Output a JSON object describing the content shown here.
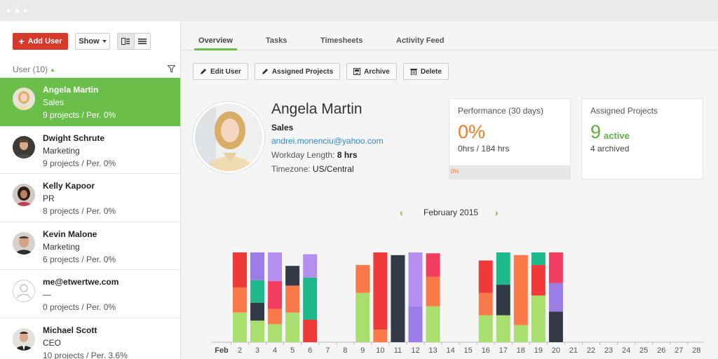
{
  "sidebar": {
    "add_user_label": "Add User",
    "show_label": "Show",
    "list_header": "User (10)",
    "users": [
      {
        "name": "Angela Martin",
        "dept": "Sales",
        "stats": "9 projects / Per. 0%",
        "selected": true
      },
      {
        "name": "Dwight Schrute",
        "dept": "Marketing",
        "stats": "9 projects / Per. 0%"
      },
      {
        "name": "Kelly Kapoor",
        "dept": "PR",
        "stats": "8 projects / Per. 0%"
      },
      {
        "name": "Kevin Malone",
        "dept": "Marketing",
        "stats": "6 projects / Per. 0%"
      },
      {
        "name": "me@etwertwe.com",
        "dept": "—",
        "stats": "0 projects / Per. 0%"
      },
      {
        "name": "Michael Scott",
        "dept": "CEO",
        "stats": "10 projects / Per. 3.6%"
      }
    ]
  },
  "tabs": [
    "Overview",
    "Tasks",
    "Timesheets",
    "Activity Feed"
  ],
  "actions": {
    "edit_user": "Edit User",
    "assigned_projects": "Assigned Projects",
    "archive": "Archive",
    "delete": "Delete"
  },
  "profile": {
    "name": "Angela Martin",
    "dept": "Sales",
    "email": "andrei.monenciu@yahoo.com",
    "workday_label": "Workday Length:",
    "workday_value": "8 hrs",
    "timezone_label": "Timezone:",
    "timezone_value": "US/Central"
  },
  "performance": {
    "label": "Performance (30 days)",
    "value": "0%",
    "hours": "0hrs / 184 hrs",
    "bar_label": "0%",
    "bar_fraction": 0
  },
  "projects": {
    "label": "Assigned Projects",
    "active_count": "9",
    "active_label": "active",
    "archived": "4 archived"
  },
  "calendar": {
    "month": "February 2015"
  },
  "colors": {
    "green": "#6abf4b",
    "red": "#d63a2b",
    "orange": "#f47b20",
    "link": "#2a8ad8"
  },
  "chart_data": {
    "type": "bar",
    "stacked": true,
    "x_prefix_label": "Feb",
    "categories": [
      "2",
      "3",
      "4",
      "5",
      "6",
      "7",
      "8",
      "9",
      "10",
      "11",
      "12",
      "13",
      "14",
      "15",
      "16",
      "17",
      "18",
      "19",
      "20",
      "21",
      "22",
      "23",
      "24",
      "25",
      "26",
      "27",
      "28"
    ],
    "palette": {
      "g": "#a9df6e",
      "o": "#f97948",
      "r": "#f03a3a",
      "d": "#333a45",
      "p": "#b58ff0",
      "t": "#1fb88a",
      "k": "#f23d5e",
      "v": "#9c7ce6"
    },
    "stacks": [
      [
        [
          "g",
          0.33
        ],
        [
          "o",
          0.28
        ],
        [
          "r",
          0.39
        ]
      ],
      [
        [
          "g",
          0.24
        ],
        [
          "d",
          0.2
        ],
        [
          "t",
          0.25
        ],
        [
          "v",
          0.31
        ]
      ],
      [
        [
          "g",
          0.2
        ],
        [
          "o",
          0.17
        ],
        [
          "k",
          0.31
        ],
        [
          "p",
          0.32
        ]
      ],
      [
        [
          "g",
          0.33
        ],
        [
          "o",
          0.3
        ],
        [
          "d",
          0.22
        ]
      ],
      [
        [
          "r",
          0.25
        ],
        [
          "t",
          0.47
        ],
        [
          "p",
          0.26
        ]
      ],
      [],
      [],
      [
        [
          "g",
          0.55
        ],
        [
          "o",
          0.31
        ]
      ],
      [
        [
          "o",
          0.14
        ],
        [
          "r",
          0.86
        ]
      ],
      [
        [
          "d",
          0.97
        ]
      ],
      [
        [
          "v",
          0.4
        ],
        [
          "p",
          0.6
        ]
      ],
      [
        [
          "g",
          0.4
        ],
        [
          "o",
          0.33
        ],
        [
          "k",
          0.26
        ]
      ],
      [],
      [],
      [
        [
          "g",
          0.3
        ],
        [
          "o",
          0.25
        ],
        [
          "r",
          0.36
        ]
      ],
      [
        [
          "g",
          0.3
        ],
        [
          "d",
          0.34
        ],
        [
          "t",
          0.36
        ]
      ],
      [
        [
          "g",
          0.19
        ],
        [
          "o",
          0.78
        ]
      ],
      [
        [
          "g",
          0.52
        ],
        [
          "r",
          0.34
        ],
        [
          "t",
          0.14
        ]
      ],
      [
        [
          "d",
          0.34
        ],
        [
          "v",
          0.32
        ],
        [
          "k",
          0.34
        ]
      ],
      [],
      [],
      [],
      [],
      [],
      [],
      [],
      []
    ]
  }
}
